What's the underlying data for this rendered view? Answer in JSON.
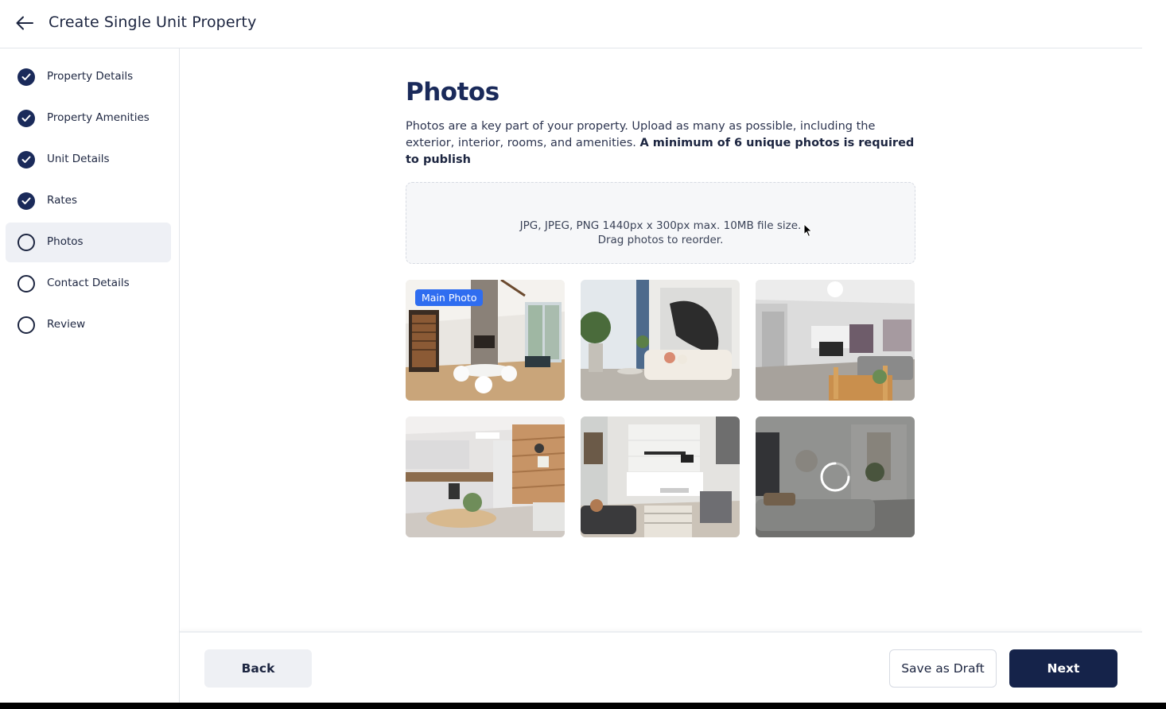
{
  "header": {
    "title": "Create Single Unit Property",
    "back_icon": "arrow-left-icon"
  },
  "sidebar": {
    "steps": [
      {
        "label": "Property Details",
        "status": "complete"
      },
      {
        "label": "Property Amenities",
        "status": "complete"
      },
      {
        "label": "Unit Details",
        "status": "complete"
      },
      {
        "label": "Rates",
        "status": "complete"
      },
      {
        "label": "Photos",
        "status": "current"
      },
      {
        "label": "Contact Details",
        "status": "incomplete"
      },
      {
        "label": "Review",
        "status": "incomplete"
      }
    ]
  },
  "main": {
    "title": "Photos",
    "description": "Photos are a key part of your property. Upload as many as possible, including the exterior, interior, rooms, and amenities.",
    "description_bold": "A minimum of 6 unique photos is required to publish",
    "dropzone": {
      "line1": "JPG, JPEG, PNG 1440px x 300px max. 10MB file size.",
      "line2": "Drag photos to reorder."
    },
    "main_photo_badge": "Main Photo",
    "photos": [
      {
        "subject": "open living room with fireplace",
        "main": true,
        "loading": false
      },
      {
        "subject": "living room with sofa and artwork",
        "main": false,
        "loading": false
      },
      {
        "subject": "living room with TV wall",
        "main": false,
        "loading": false
      },
      {
        "subject": "kitchen with wood accent wall",
        "main": false,
        "loading": false
      },
      {
        "subject": "living room and kitchen",
        "main": false,
        "loading": false
      },
      {
        "subject": "living room with grey sofa",
        "main": false,
        "loading": true
      }
    ]
  },
  "footer": {
    "back_label": "Back",
    "draft_label": "Save as Draft",
    "next_label": "Next"
  },
  "colors": {
    "navy": "#15234a",
    "accent_blue": "#2f6df0",
    "active_step_bg": "#eef0f5"
  }
}
